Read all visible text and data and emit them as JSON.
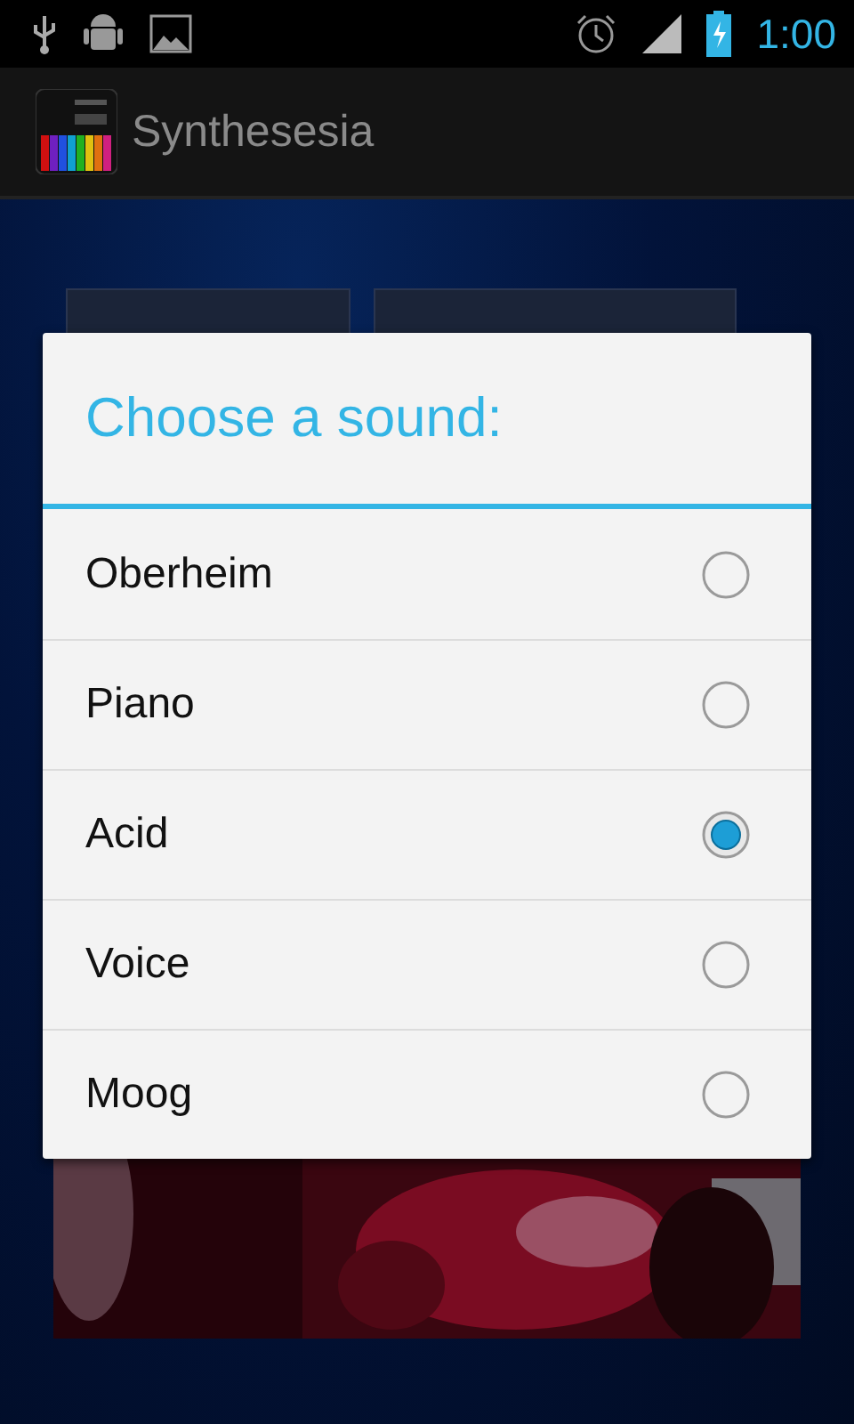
{
  "status_bar": {
    "time": "1:00"
  },
  "app_bar": {
    "title": "Synthesesia"
  },
  "buttons": [
    {
      "kind": "button"
    },
    {
      "kind": "button"
    }
  ],
  "dialog": {
    "title": "Choose a sound:",
    "options": [
      {
        "label": "Oberheim",
        "selected": false
      },
      {
        "label": "Piano",
        "selected": false
      },
      {
        "label": "Acid",
        "selected": true
      },
      {
        "label": "Voice",
        "selected": false
      },
      {
        "label": "Moog",
        "selected": false
      }
    ]
  }
}
